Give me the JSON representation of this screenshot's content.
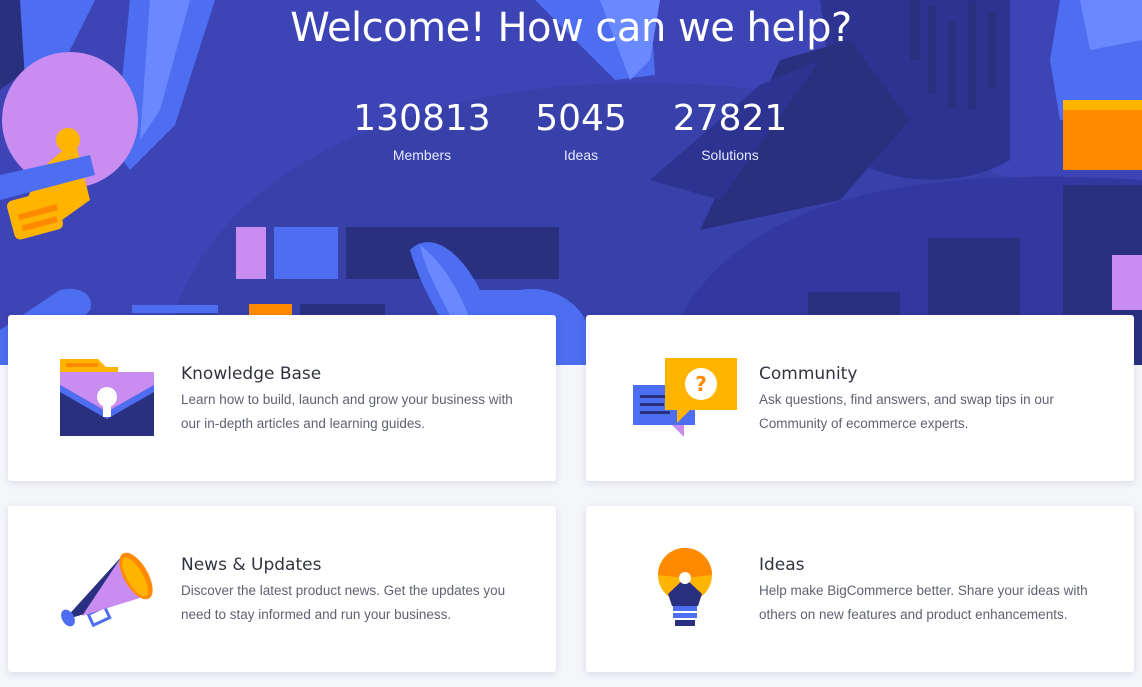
{
  "hero": {
    "title": "Welcome! How can we help?",
    "stats": [
      {
        "number": "130813",
        "label": "Members"
      },
      {
        "number": "5045",
        "label": "Ideas"
      },
      {
        "number": "27821",
        "label": "Solutions"
      }
    ]
  },
  "cards": [
    {
      "title": "Knowledge Base",
      "description": "Learn how to build, launch and grow your business with our in-depth articles and learning guides.",
      "icon": "folder-lightbulb-icon"
    },
    {
      "title": "Community",
      "description": "Ask questions, find answers, and swap tips in our Community of ecommerce experts.",
      "icon": "chat-bubbles-icon"
    },
    {
      "title": "News & Updates",
      "description": "Discover the latest product news. Get the updates you need to stay informed and run your business.",
      "icon": "megaphone-icon"
    },
    {
      "title": "Ideas",
      "description": "Help make BigCommerce better. Share your ideas with others on new features and product enhancements.",
      "icon": "lightbulb-icon"
    }
  ],
  "colors": {
    "hero_bg": "#3d44b5",
    "navy": "#2a3080",
    "accent_blue": "#4d6ef0",
    "accent_purple": "#c98cf0",
    "accent_orange": "#ff8a00",
    "accent_yellow": "#ffb400"
  }
}
